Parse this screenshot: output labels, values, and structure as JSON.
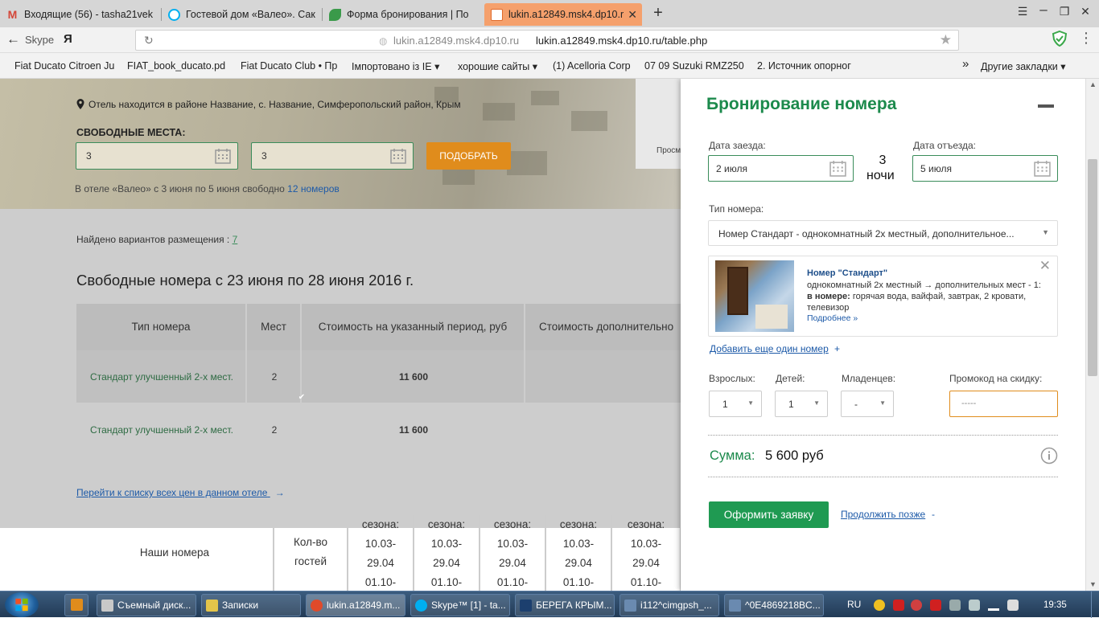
{
  "browser": {
    "tabs": [
      {
        "label": "Входящие (56) - tasha21vek",
        "icon": "gmail-icon",
        "color": "#d44638"
      },
      {
        "label": "Гостевой дом «Валео». Сак",
        "icon": "skype-icon",
        "color": "#00aff0"
      },
      {
        "label": "Форма бронирования | По",
        "icon": "leaf-icon",
        "color": "#3a9a4a"
      },
      {
        "label": "lukin.a12849.msk4.dp10.r",
        "icon": "page-icon",
        "color": "#e06a2a"
      }
    ],
    "address": {
      "host": "lukin.a12849.msk4.dp10.ru",
      "url": "lukin.a12849.msk4.dp10.ru/table.php"
    },
    "skype_label": "Skype",
    "yandex_label": "Я",
    "bookmarks": [
      "Fiat Ducato Citroen Ju",
      "FIAT_book_ducato.pd",
      "Fiat Ducato Club • Пр",
      "Імпортовано із IE",
      "хорошие сайты",
      "(1) Acelloria Corp",
      "07 09 Suzuki RMZ250",
      "2. Источник опорног"
    ],
    "bookmarks_more": "»",
    "other_bookmarks": "Другие закладки"
  },
  "hero": {
    "location": "Отель находится в районе Название, с. Название, Симферопольский район, Крым",
    "free_places_label": "СВОБОДНЫЕ МЕСТА:",
    "input1": "3",
    "input2": "3",
    "pick_button": "ПОДОБРАТЬ",
    "hotel_free_text": "В отеле «Валео» с 3 июня по 5 июня свободно",
    "hotel_free_link": "12 номеров",
    "side_text": "Просм"
  },
  "results": {
    "found_label": "Найдено вариантов размещения :",
    "found_count": "7",
    "title": "Свободные номера с 23 июня по 28 июня 2016 г.",
    "columns": [
      "Тип номера",
      "Мест",
      "Стоимость на указанный период, руб",
      "Стоимость дополнительно"
    ],
    "rows": [
      {
        "name": "Стандарт улучшенный 2-х мест.",
        "places": "2",
        "price": "11 600"
      },
      {
        "name": "Стандарт улучшенный 2-х мест.",
        "places": "2",
        "price": "11 600"
      }
    ],
    "all_prices_link": "Перейти к списку всех цен в данном отеле",
    "all_prices_arrow": "→"
  },
  "bottom_table": {
    "our_rooms": "Наши номера",
    "guests": "Кол-во гостей",
    "season_cols": [
      {
        "top": "сезона:",
        "range": "10.03- 29.04 01.10-"
      },
      {
        "top": "сезона:",
        "range": "10.03- 29.04 01.10-"
      },
      {
        "top": "сезона:",
        "range": "10.03- 29.04 01.10-"
      },
      {
        "top": "сезона:",
        "range": "10.03- 29.04 01.10-"
      },
      {
        "top": "сезона:",
        "range": "10.03- 29.04 01.10-"
      }
    ]
  },
  "booking": {
    "title": "Бронирование номера",
    "checkin_label": "Дата заезда:",
    "checkin_value": "2 июля",
    "checkout_label": "Дата отъезда:",
    "checkout_value": "5 июля",
    "nights_num": "3",
    "nights_word": "ночи",
    "roomtype_label": "Тип номера:",
    "roomtype_value": "Номер Стандарт - однокомнатный 2х местный, дополнительное...",
    "room_card": {
      "name": "Номер \"Стандарт\"",
      "desc1": "однокомнатный 2х местный → дополнительных мест - 1:",
      "desc2_bold": "в номере:",
      "desc2": " горячая вода, вайфай, завтрак, 2 кровати, телевизор",
      "more": "Подробнее »"
    },
    "add_room": "Добавить еще один номер",
    "add_room_plus": "+",
    "adults_label": "Взрослых:",
    "adults_value": "1",
    "children_label": "Детей:",
    "children_value": "1",
    "infants_label": "Младенцев:",
    "infants_value": "-",
    "promo_label": "Промокод на скидку:",
    "promo_placeholder": "-----",
    "sum_label": "Сумма:",
    "sum_value": "5 600 руб",
    "submit": "Оформить заявку",
    "later": "Продолжить позже",
    "later_dash": "-"
  },
  "taskbar": {
    "items": [
      {
        "label": "Съемный диск...",
        "color": "#c8c8c8"
      },
      {
        "label": "Записки",
        "color": "#e3c44a"
      },
      {
        "label": "lukin.a12849.m...",
        "color": "#e04a2a"
      },
      {
        "label": "Skype™ [1] - ta...",
        "color": "#00aff0"
      },
      {
        "label": "БЕРЕГА КРЫМ...",
        "color": "#1c3f6e"
      },
      {
        "label": "i112^cimgpsh_...",
        "color": "#6a8ab0"
      },
      {
        "label": "^0E4869218BC...",
        "color": "#6a8ab0"
      }
    ],
    "lang": "RU",
    "clock": "19:35"
  }
}
